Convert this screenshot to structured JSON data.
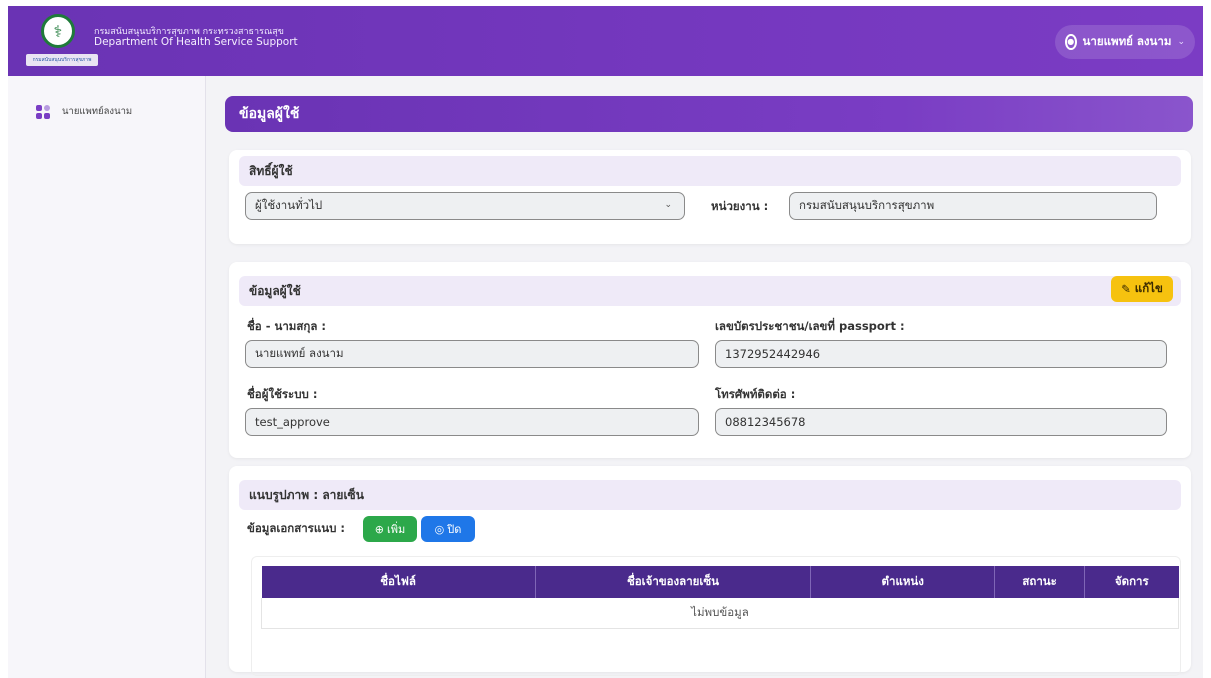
{
  "header": {
    "org_th": "กรมสนับสนุนบริการสุขภาพ กระทรวงสาธารณสุข",
    "org_en": "Department Of Health Service Support",
    "user_name": "นายแพทย์ ลงนาม",
    "logo_text": "กรมสนับสนุนบริการสุขภาพ"
  },
  "sidebar": {
    "items": [
      {
        "label": "นายแพทย์ลงนาม"
      }
    ]
  },
  "page": {
    "title": "ข้อมูลผู้ใช้"
  },
  "permission": {
    "header": "สิทธิ์ผู้ใช้",
    "role_value": "ผู้ใช้งานทั่วไป",
    "agency_label": "หน่วยงาน :",
    "agency_value": "กรมสนับสนุนบริการสุขภาพ"
  },
  "user_info": {
    "header": "ข้อมูลผู้ใช้",
    "edit_label": "แก้ไข",
    "fullname_label": "ชื่อ - นามสกุล :",
    "fullname_value": "นายแพทย์ ลงนาม",
    "idcard_label": "เลขบัตรประชาชน/เลขที่ passport :",
    "idcard_value": "1372952442946",
    "username_label": "ชื่อผู้ใช้ระบบ :",
    "username_value": "test_approve",
    "phone_label": "โทรศัพท์ติดต่อ :",
    "phone_value": "08812345678"
  },
  "signature": {
    "header": "แนบรูปภาพ : ลายเซ็น",
    "attach_label": "ข้อมูลเอกสารแนบ :",
    "add_label": "เพิ่ม",
    "close_label": "ปิด",
    "columns": [
      "ชื่อไฟล์",
      "ชื่อเจ้าของลายเซ็น",
      "ตำแหน่ง",
      "สถานะ",
      "จัดการ"
    ],
    "empty_text": "ไม่พบข้อมูล"
  },
  "colors": {
    "brand_purple": "#6a33b4",
    "table_header": "#4a2a8c",
    "edit_yellow": "#f6c20f",
    "add_green": "#2ca84a",
    "close_blue": "#1f77e8"
  }
}
